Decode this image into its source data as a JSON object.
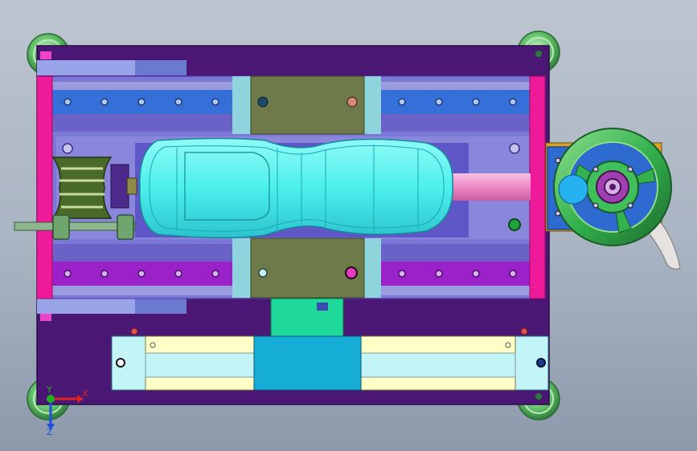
{
  "viewport": {
    "background_top": "#bcc5d0",
    "background_bottom": "#8c99ab"
  },
  "colors": {
    "base_plate": "#4a1874",
    "rail_blue": "#3570d8",
    "rail_purple": "#9a22c8",
    "end_bar_magenta": "#ee1a9a",
    "slider_olive": "#6e7a4a",
    "mold_cyan": "#4cf0ec",
    "cylinder_body": "#ffffc8",
    "cylinder_block": "#16aed6",
    "handwheel_green": "#33b24d",
    "hub_blue": "#2d6bd0",
    "guide_plate": "#6a62c6",
    "piston_rod_pink": "#ee88c6",
    "connector_teal": "#1fd99a"
  },
  "icons": {
    "corner_feet": "leveling-foot-icon",
    "handwheel": "handwheel-icon",
    "clamp": "toggle-clamp-icon",
    "triad": "coordinate-triad-icon"
  },
  "triad": {
    "x_label": "X",
    "y_label": "Y",
    "z_label": "Z",
    "x_color": "#e02020",
    "y_color": "#20b020",
    "z_color": "#2050e0"
  }
}
